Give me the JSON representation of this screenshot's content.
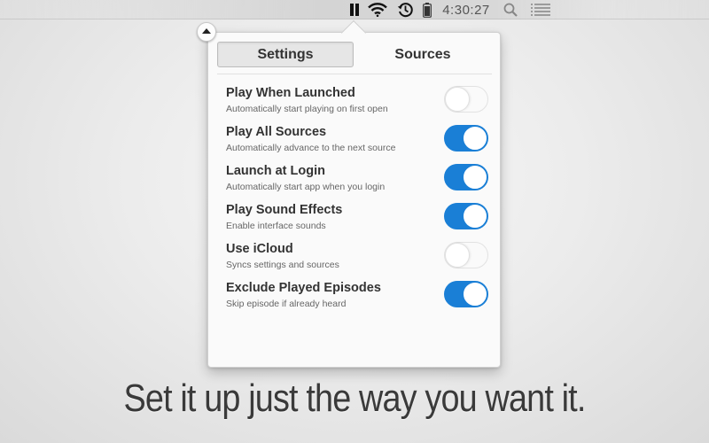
{
  "menubar": {
    "icons": [
      "pause-icon",
      "wifi-icon",
      "time-machine-icon",
      "battery-icon",
      "spotlight-search-icon",
      "notification-center-icon"
    ],
    "clock": "4:30:27"
  },
  "popover": {
    "collapse_icon": "triangle-up-icon",
    "tabs": [
      {
        "label": "Settings",
        "active": true
      },
      {
        "label": "Sources",
        "active": false
      }
    ],
    "settings": [
      {
        "title": "Play When Launched",
        "description": "Automatically start playing on first open",
        "enabled": false
      },
      {
        "title": "Play All Sources",
        "description": "Automatically advance to the next source",
        "enabled": true
      },
      {
        "title": "Launch at Login",
        "description": "Automatically start app when you login",
        "enabled": true
      },
      {
        "title": "Play Sound Effects",
        "description": "Enable interface sounds",
        "enabled": true
      },
      {
        "title": "Use iCloud",
        "description": "Syncs settings and sources",
        "enabled": false
      },
      {
        "title": "Exclude Played Episodes",
        "description": "Skip episode if already heard",
        "enabled": true
      }
    ],
    "toggle_on_color": "#1a7fd6"
  },
  "tagline": "Set it up just the way you want it."
}
